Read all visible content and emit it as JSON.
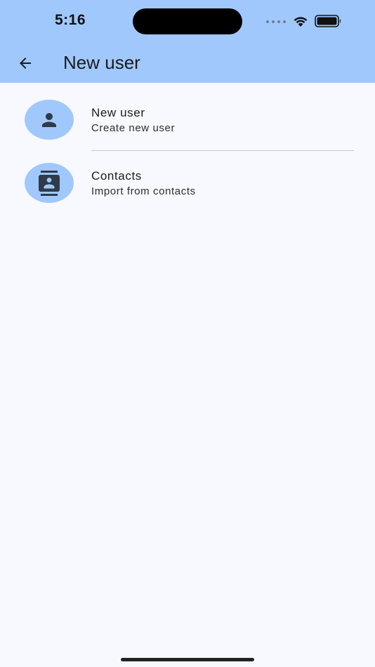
{
  "status_bar": {
    "time": "5:16"
  },
  "header": {
    "title": "New user",
    "back_icon": "arrow-back-icon",
    "background": "#a1c8fc"
  },
  "list": {
    "items": [
      {
        "icon": "person-icon",
        "title": "New user",
        "subtitle": "Create new user"
      },
      {
        "icon": "contacts-icon",
        "title": "Contacts",
        "subtitle": "Import from contacts"
      }
    ]
  },
  "colors": {
    "accent": "#a1c8fc",
    "background": "#f7f9fe",
    "icon": "#2f3a4a"
  }
}
